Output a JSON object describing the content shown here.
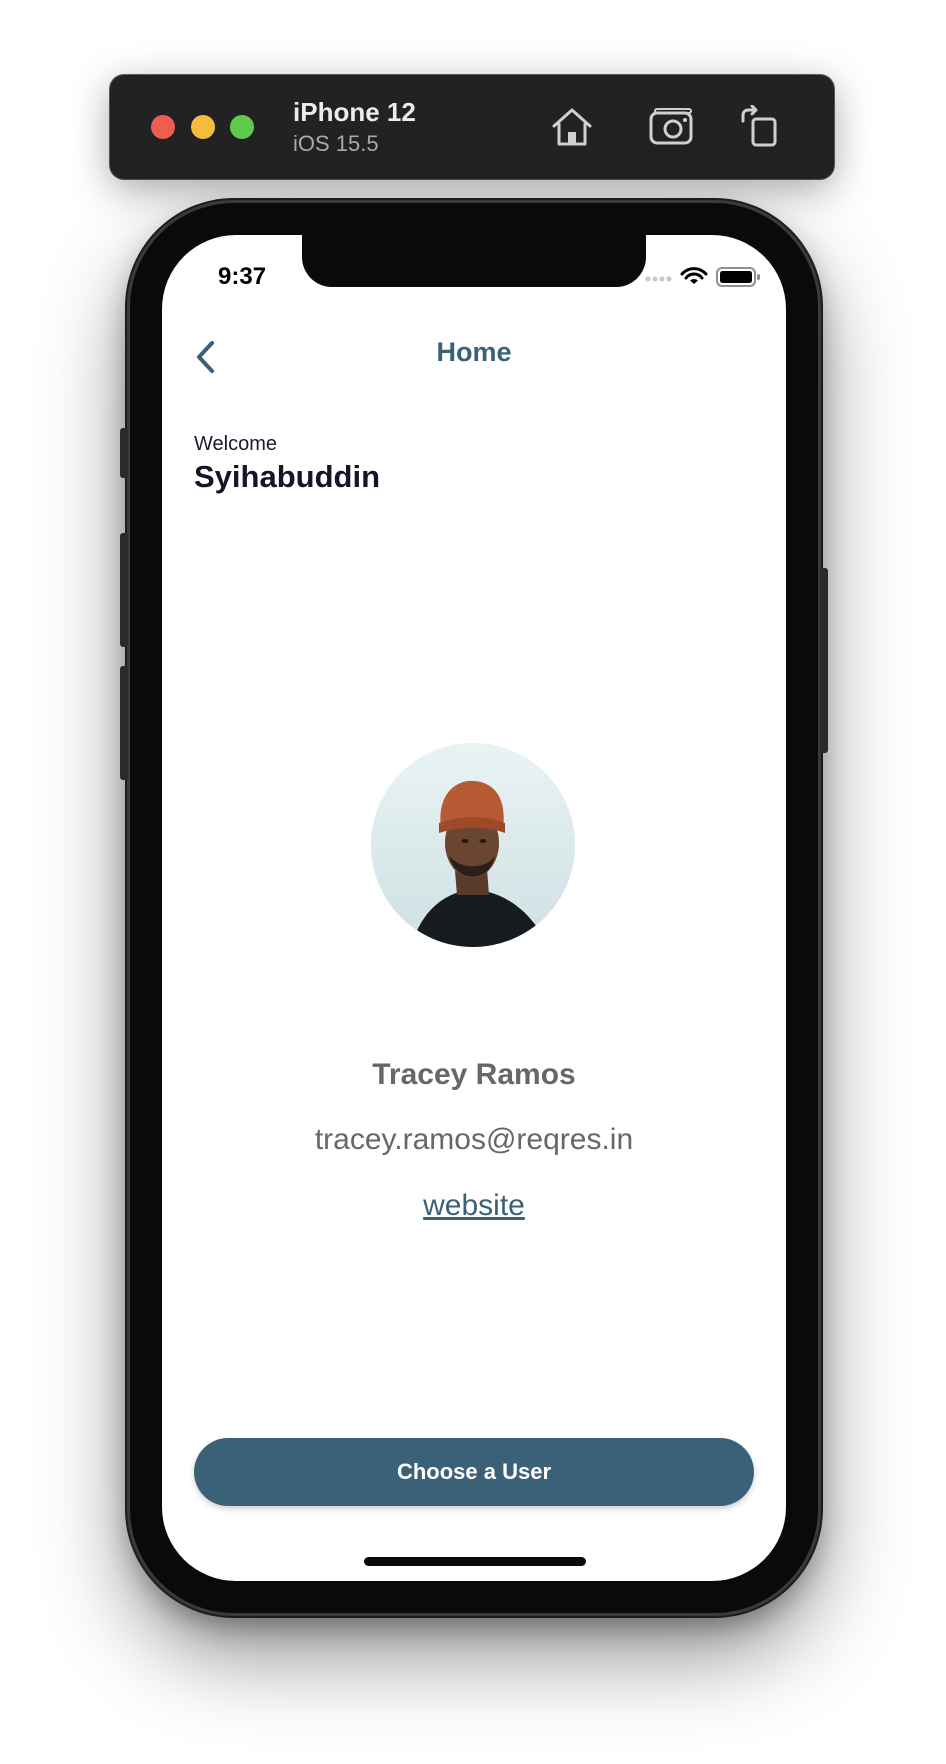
{
  "simulator": {
    "device_name": "iPhone 12",
    "os_version": "iOS 15.5",
    "icons": [
      "home-icon",
      "screenshot-icon",
      "rotate-icon"
    ]
  },
  "status_bar": {
    "time": "9:37",
    "icons": [
      "signal-icon",
      "wifi-icon",
      "battery-icon"
    ]
  },
  "nav": {
    "back_icon": "chevron-left-icon",
    "title": "Home"
  },
  "welcome": {
    "label": "Welcome",
    "name": "Syihabuddin"
  },
  "user": {
    "avatar_icon": "avatar",
    "name": "Tracey Ramos",
    "email": "tracey.ramos@reqres.in",
    "website_label": "website"
  },
  "actions": {
    "choose_user_label": "Choose a User"
  },
  "colors": {
    "accent": "#3a6178",
    "secondary_text": "#676767",
    "primary_text": "#14142a"
  }
}
